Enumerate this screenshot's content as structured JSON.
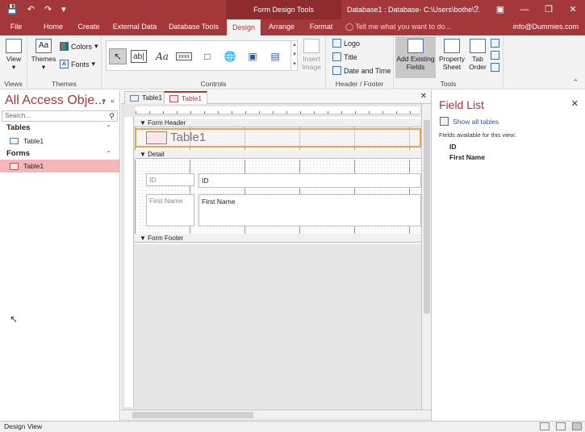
{
  "titlebar": {
    "context": "Form Design Tools",
    "doc_title": "Database1 : Database- C:\\Users\\bothe\\..."
  },
  "tabs": {
    "file": "File",
    "home": "Home",
    "create": "Create",
    "external": "External Data",
    "dbtools": "Database Tools",
    "design": "Design",
    "arrange": "Arrange",
    "format": "Format",
    "tellme": "Tell me what you want to do...",
    "account": "info@Dummies.com"
  },
  "ribbon": {
    "view": "View",
    "themes": "Themes",
    "colors": "Colors",
    "fonts": "Fonts",
    "insert_image": "Insert Image",
    "logo": "Logo",
    "title": "Title",
    "date_time": "Date and Time",
    "add_fields": "Add Existing Fields",
    "property_sheet": "Property Sheet",
    "tab_order": "Tab Order",
    "group_views": "Views",
    "group_themes": "Themes",
    "group_controls": "Controls",
    "group_header_footer": "Header / Footer",
    "group_tools": "Tools"
  },
  "nav": {
    "title": "All Access Obje...",
    "search_placeholder": "Search...",
    "group_tables": "Tables",
    "table1": "Table1",
    "group_forms": "Forms",
    "form1": "Table1"
  },
  "doc": {
    "tab1": "Table1",
    "tab2": "Table1",
    "form_header": "Form Header",
    "header_title": "Table1",
    "detail": "Detail",
    "id_label": "ID",
    "id_text": "ID",
    "firstname_label": "First Name",
    "firstname_text": "First Name",
    "form_footer": "Form Footer"
  },
  "fieldlist": {
    "title": "Field List",
    "show_all": "Show all tables",
    "note": "Fields available for this view:",
    "fields": [
      "ID",
      "First Name"
    ]
  },
  "status": {
    "text": "Design View"
  }
}
